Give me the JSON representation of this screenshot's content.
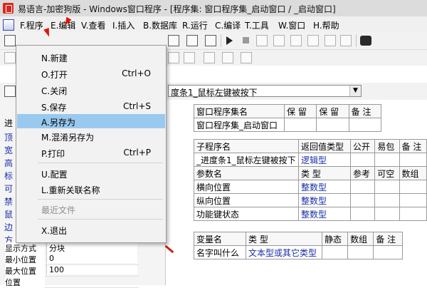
{
  "window": {
    "title": "易语言-加密狗版 - Windows窗口程序 - [程序集: 窗口程序集_启动窗口 / _启动窗口]"
  },
  "menubar": {
    "items": [
      "F.程序",
      "E.编辑",
      "V.查看",
      "I.插入",
      "B.数据库",
      "R.运行",
      "C.编译",
      "T.工具",
      "W.窗口",
      "H.帮助"
    ]
  },
  "file_menu": {
    "items": [
      {
        "label": "N.新建",
        "shortcut": ""
      },
      {
        "label": "O.打开",
        "shortcut": "Ctrl+O"
      },
      {
        "label": "C.关闭",
        "shortcut": ""
      },
      {
        "label": "S.保存",
        "shortcut": "Ctrl+S"
      },
      {
        "label": "A.另存为",
        "shortcut": ""
      },
      {
        "label": "M.混淆另存为",
        "shortcut": ""
      },
      {
        "label": "P.打印",
        "shortcut": "Ctrl+P"
      },
      {
        "label": "U.配置",
        "shortcut": ""
      },
      {
        "label": "L.重新关联名称",
        "shortcut": ""
      },
      {
        "label": "最近文件",
        "shortcut": ""
      },
      {
        "label": "X.退出",
        "shortcut": ""
      }
    ]
  },
  "event_combo": {
    "value": "度条1_鼠标左键被按下"
  },
  "left_panel": {
    "tab_label": "进",
    "side_chars": [
      "顶",
      "宽",
      "高",
      "标",
      "可",
      "禁",
      "鼠",
      "边",
      "方"
    ],
    "properties": [
      {
        "key": "显示方式",
        "value": "分块"
      },
      {
        "key": "最小位置",
        "value": "0"
      },
      {
        "key": "最大位置",
        "value": "100"
      },
      {
        "key": "位置",
        "value": ""
      }
    ]
  },
  "assembly_table": {
    "headers": [
      "窗口程序集名",
      "保 留",
      "保 留",
      "备 注"
    ],
    "row": [
      "窗口程序集_启动窗口",
      "",
      "",
      ""
    ]
  },
  "sub_table": {
    "headers": [
      "子程序名",
      "返回值类型",
      "公开",
      "易包",
      "备 注"
    ],
    "row": [
      "_进度条1_鼠标左键被按下",
      "逻辑型",
      "",
      "",
      ""
    ]
  },
  "param_table": {
    "headers": [
      "参数名",
      "类 型",
      "参考",
      "可空",
      "数组"
    ],
    "rows": [
      [
        "横向位置",
        "整数型"
      ],
      [
        "纵向位置",
        "整数型"
      ],
      [
        "功能键状态",
        "整数型"
      ]
    ]
  },
  "var_table": {
    "headers": [
      "变量名",
      "类 型",
      "静态",
      "数组",
      "备 注"
    ],
    "row": [
      "名字叫什么",
      "文本型或其它类型",
      "",
      "",
      ""
    ]
  }
}
